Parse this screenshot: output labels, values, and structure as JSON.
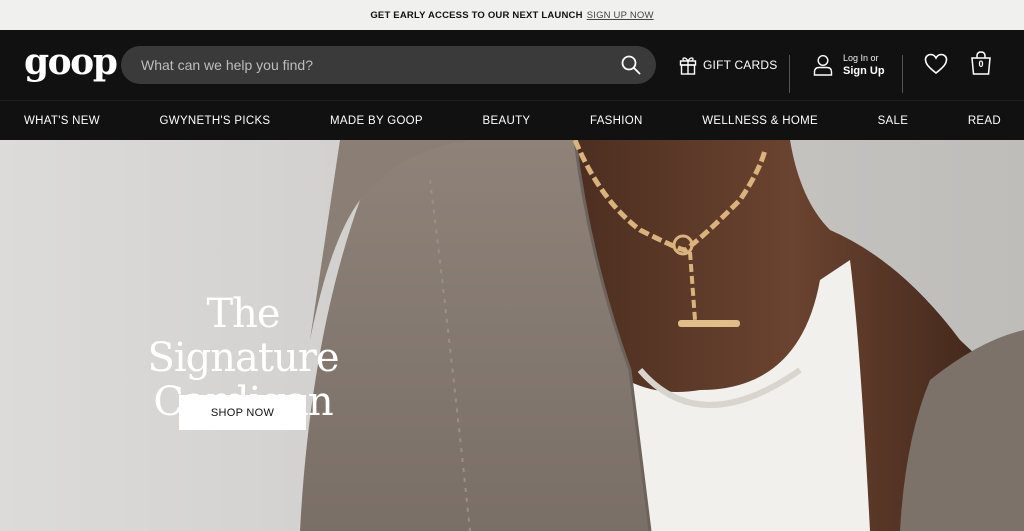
{
  "announcement": {
    "text": "GET EARLY ACCESS TO OUR NEXT LAUNCH",
    "link": "SIGN UP NOW"
  },
  "header": {
    "logo": "goop",
    "search_placeholder": "What can we help you find?",
    "gift_cards": "GIFT CARDS",
    "login_line1": "Log In or",
    "login_line2": "Sign Up",
    "bag_count": "0"
  },
  "nav": [
    "WHAT'S NEW",
    "GWYNETH'S PICKS",
    "MADE BY GOOP",
    "BEAUTY",
    "FASHION",
    "WELLNESS & HOME",
    "SALE",
    "READ"
  ],
  "hero": {
    "title_line1": "The Signature",
    "title_line2": "Cardigan",
    "cta": "SHOP NOW"
  },
  "colors": {
    "header_bg": "#111111",
    "announce_bg": "#f0f0ee",
    "search_bg": "#3a3a3a"
  },
  "icons": [
    "search-icon",
    "gift-icon",
    "user-icon",
    "heart-icon",
    "bag-icon"
  ]
}
